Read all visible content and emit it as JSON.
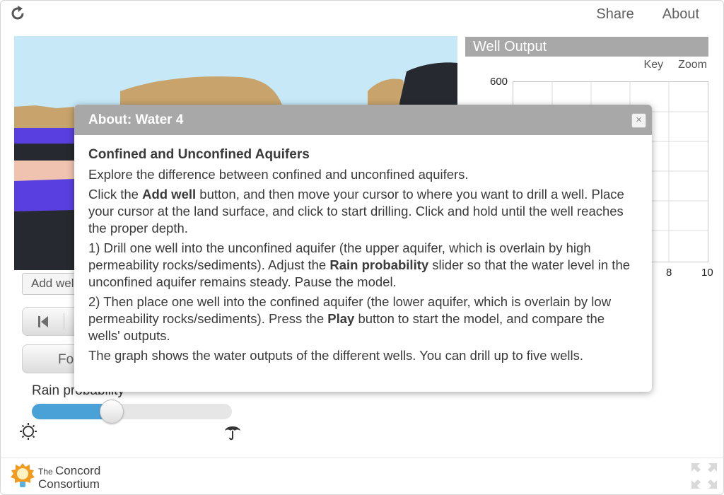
{
  "topnav": {
    "share_label": "Share",
    "about_label": "About"
  },
  "controls": {
    "add_well_label": "Add well",
    "follow_label": "Follow",
    "rain_label": "Rain probability",
    "rain_probability": 0.4
  },
  "graph": {
    "title": "Well Output",
    "key_label": "Key",
    "zoom_label": "Zoom",
    "y_max_label": "600",
    "x_tick_8": "8",
    "x_tick_10": "10"
  },
  "dialog": {
    "title": "About: Water 4",
    "close_glyph": "×",
    "heading": "Confined and Unconfined Aquifers",
    "intro": "Explore the difference between confined and unconfined aquifers.",
    "p1_a": "Click the ",
    "p1_b": "Add well",
    "p1_c": " button, and then move your cursor to where you want to drill a well. Place your cursor at the land surface, and click to start drilling. Click and hold until the well reaches the proper depth.",
    "p2_a": "1) Drill one well into the unconfined aquifer (the upper aquifer, which is overlain by high permeability rocks/sediments). Adjust the ",
    "p2_b": "Rain probability",
    "p2_c": " slider so that the water level in the unconfined aquifer remains steady. Pause the model.",
    "p3_a": "2) Then place one well into the confined aquifer (the lower aquifer, which is overlain by low permeability rocks/sediments). Press the ",
    "p3_b": "Play",
    "p3_c": " button to start the model, and compare the wells' outputs.",
    "p4": "The graph shows the water outputs of the different wells. You can drill up to five wells."
  },
  "footer": {
    "logo_line1_small": "The",
    "logo_line1_big": "Concord",
    "logo_line2": "Consortium"
  },
  "colors": {
    "sky": "#c6e8f7",
    "sand": "#c8a46c",
    "water": "#5a3fe0",
    "rock": "#262a30",
    "clay": "#f0c3b0",
    "slider_fill": "#4aa1d8",
    "header_gray": "#a8a8a8"
  }
}
